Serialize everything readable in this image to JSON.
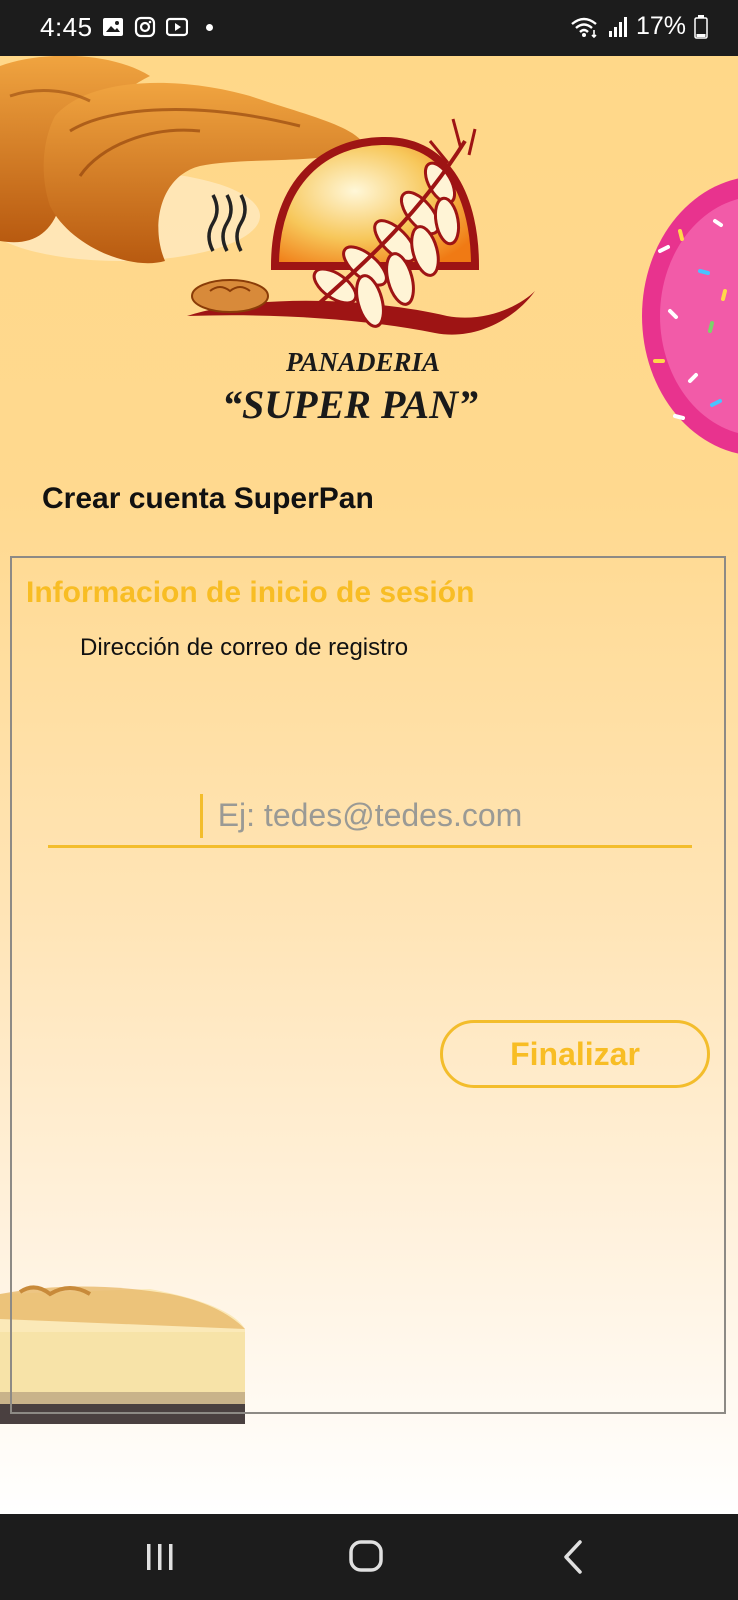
{
  "status_bar": {
    "time": "4:45",
    "battery": "17%",
    "left_icons": [
      "gallery-icon",
      "instagram-icon",
      "youtube-icon",
      "notification-dot"
    ],
    "right_icons": [
      "wifi-icon",
      "signal-icon",
      "battery-icon"
    ]
  },
  "logo": {
    "line1": "PANADERIA",
    "line2": "“SUPER PAN”"
  },
  "page": {
    "title": "Crear cuenta SuperPan"
  },
  "form": {
    "section_title": "Informacion de inicio de sesión",
    "email_label": "Dirección de correo de registro",
    "email_value": "",
    "email_placeholder": "Ej: tedes@tedes.com",
    "finish_label": "Finalizar"
  },
  "nav_bar": {
    "buttons": [
      "recents-icon",
      "home-icon",
      "back-icon"
    ]
  },
  "colors": {
    "accent": "#f8bd24",
    "status_bar": "#1c1c1c",
    "background_top": "#ffd889",
    "logo_red": "#9e1414"
  }
}
